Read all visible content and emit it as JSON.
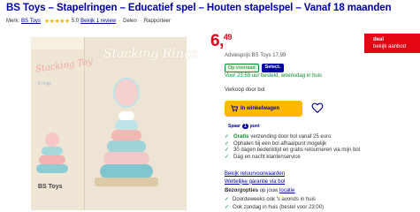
{
  "product": {
    "title": "BS Toys – Stapelringen – Educatief spel – Houten stapelspel – Vanaf 18 maanden",
    "brand_prefix": "Merk:",
    "brand_name": "BS Toys",
    "rating": "5,0",
    "review_link": "Bekijk 1 review",
    "share": "Delen",
    "report": "Rapporteer"
  },
  "image": {
    "box_title": "Stacking Rings",
    "side_title": "Stacking Toy",
    "side_small": "6 rings",
    "brand_mark": "BS Toys"
  },
  "pricing": {
    "price_main": "6",
    "price_cents": "49",
    "advice": "Adviesprijs BS Toys 17,99",
    "deal_label": "deal",
    "deal_link": "bekijk aanbod"
  },
  "availability": {
    "stock_badge": "Op voorraad",
    "select_badge": "Select.",
    "delivery": "Voor 23:59 uur besteld, woensdag in huis"
  },
  "seller": "Verkoop door bol",
  "actions": {
    "cart_label": "In winkelwagen"
  },
  "spaar": {
    "prefix": "Spaar",
    "count": "1",
    "suffix": "punt"
  },
  "usps": [
    {
      "highlight": "Gratis",
      "text": "verzending door bol vanaf 25 euro"
    },
    {
      "highlight": "",
      "text": "Ophalen bij een bol afhaalpunt mogelijk"
    },
    {
      "highlight": "",
      "text": "30 dagen bedenktijd en gratis retourneren via mijn bol"
    },
    {
      "highlight": "",
      "text": "Dag en nacht klantenservice"
    }
  ],
  "links": {
    "returns": "Bekijk retourvoorwaarden",
    "warranty": "Wettelijke garantie via bol"
  },
  "delivery_options": {
    "title": "Bezorgopties",
    "location_prefix": "op jouw",
    "location_link": "locatie",
    "option1": "Doordeweeks ook 's avonds in huis",
    "option2": "Ook zondag in huis (bestel voor 23:00)"
  },
  "colors": {
    "brand_blue": "#0000a4",
    "price_red": "#e00020",
    "cart_yellow": "#ffb800",
    "success_green": "#0a8a23"
  }
}
